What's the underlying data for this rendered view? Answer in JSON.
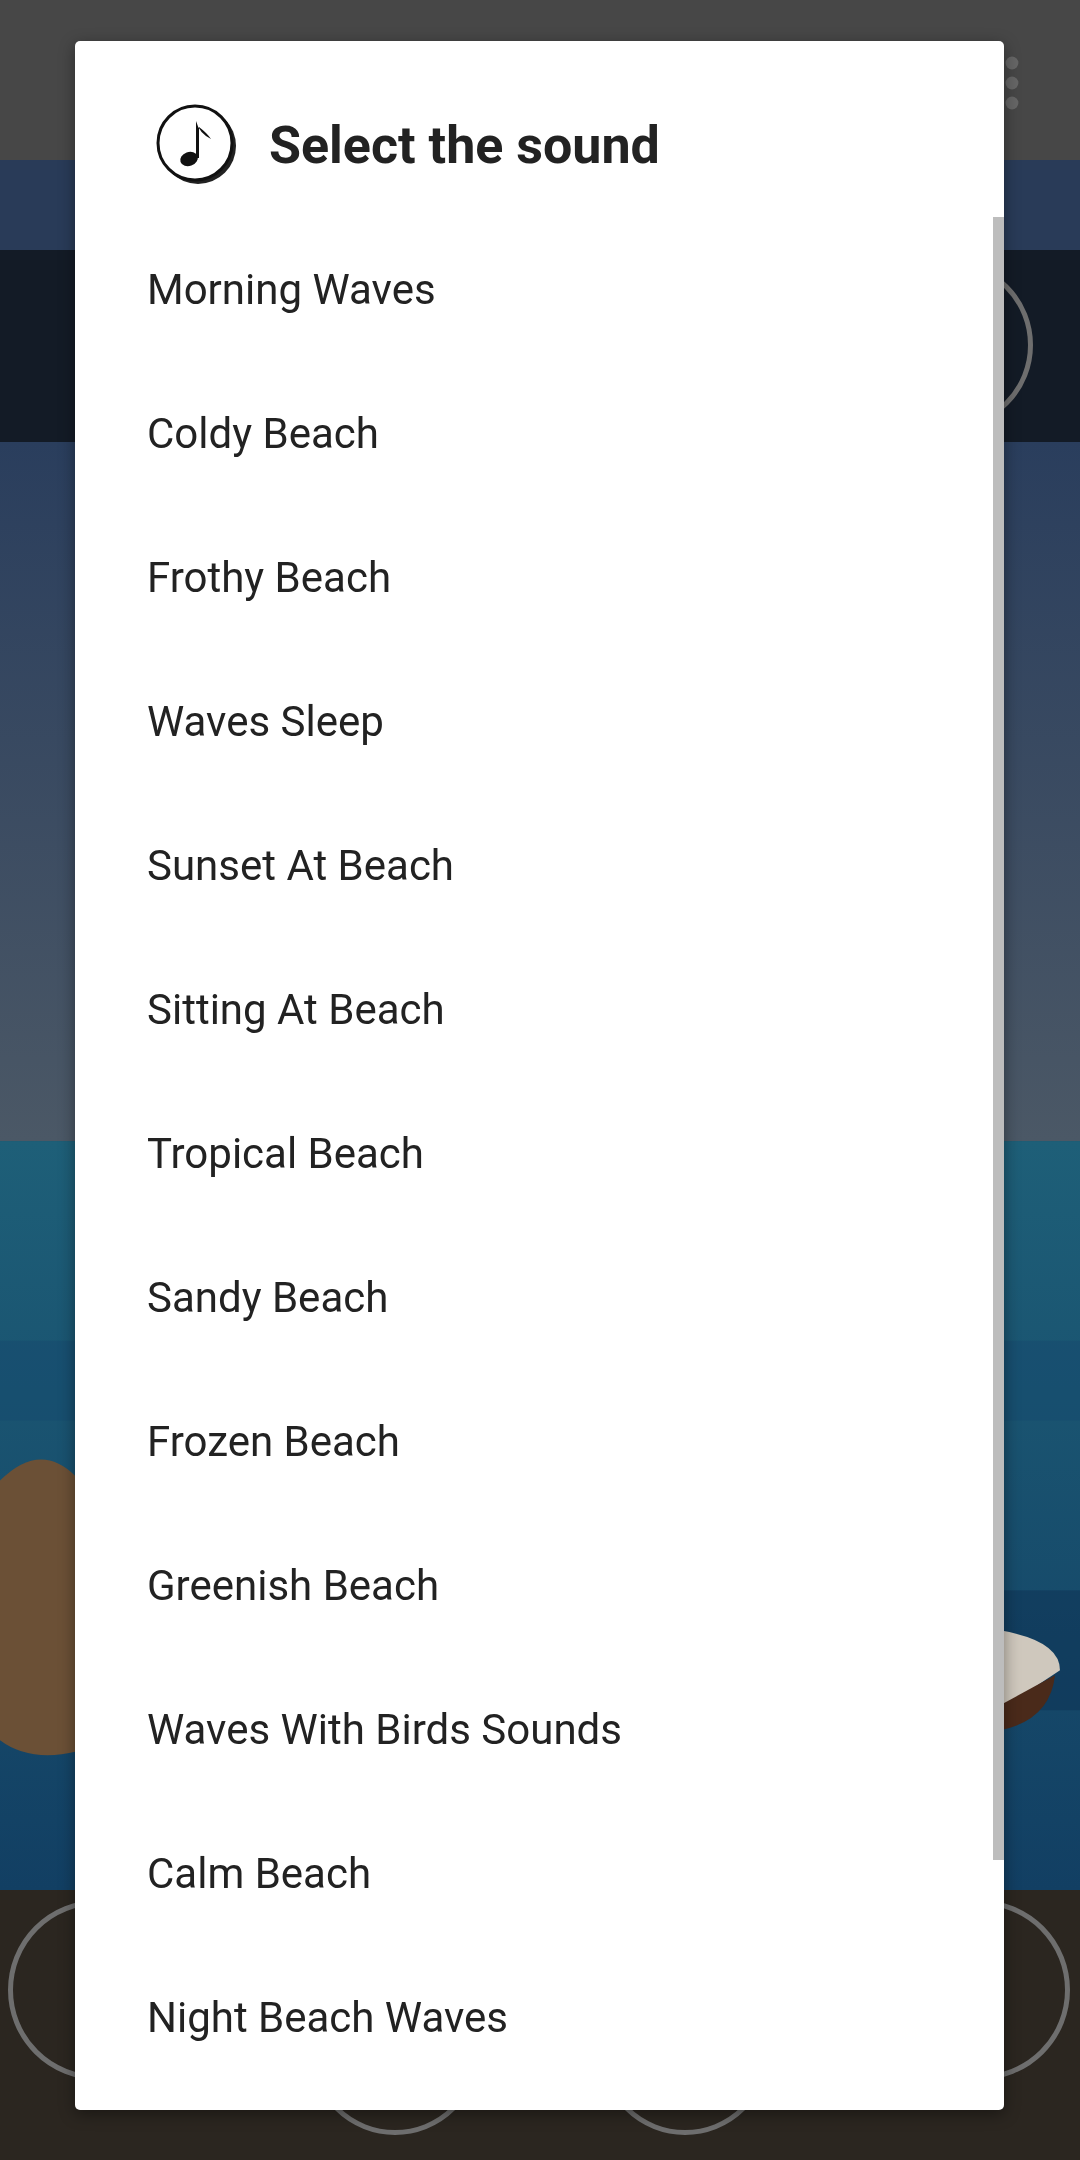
{
  "dialog": {
    "title": "Select the sound",
    "items": [
      "Morning Waves",
      "Coldy Beach",
      "Frothy Beach",
      "Waves Sleep",
      "Sunset At Beach",
      "Sitting At Beach",
      "Tropical Beach",
      "Sandy Beach",
      "Frozen Beach",
      "Greenish Beach",
      "Waves With Birds Sounds",
      "Calm Beach",
      "Night Beach Waves"
    ]
  }
}
